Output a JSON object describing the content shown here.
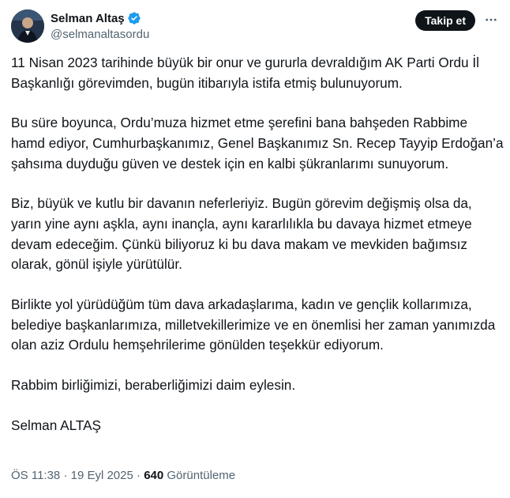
{
  "author": {
    "display_name": "Selman Altaş",
    "handle": "@selmanaltasordu"
  },
  "actions": {
    "follow_label": "Takip et"
  },
  "tweet": {
    "paragraphs": [
      "11 Nisan 2023 tarihinde büyük bir onur ve gururla devraldığım AK Parti Ordu İl Başkanlığı görevimden, bugün itibarıyla istifa etmiş bulunuyorum.",
      "Bu süre boyunca, Ordu’muza hizmet etme şerefini bana bahşeden Rabbime hamd ediyor, Cumhurbaşkanımız, Genel Başkanımız Sn. Recep Tayyip Erdoğan’a şahsıma duyduğu güven ve destek için en kalbi şükranlarımı sunuyorum.",
      "Biz, büyük ve kutlu bir davanın neferleriyiz. Bugün görevim değişmiş olsa da, yarın yine aynı aşkla, aynı inançla, aynı kararlılıkla bu davaya hizmet etmeye devam edeceğim. Çünkü biliyoruz ki bu dava makam ve mevkiden bağımsız olarak, gönül işiyle yürütülür.",
      "Birlikte yol yürüdüğüm tüm dava arkadaşlarıma, kadın ve gençlik kollarımıza, belediye başkanlarımıza, milletvekillerimize ve en önemlisi her zaman yanımızda olan aziz Ordulu hemşehrilerime gönülden teşekkür ediyorum.",
      "Rabbim birliğimizi, beraberliğimizi daim eylesin.",
      "Selman ALTAŞ"
    ]
  },
  "meta": {
    "time": "ÖS 11:38",
    "date": "19 Eyl 2025",
    "separator": "·",
    "views_count": "640",
    "views_label": "Görüntüleme"
  },
  "colors": {
    "text": "#0f1419",
    "secondary": "#536471",
    "verified": "#1d9bf0"
  },
  "icons": {
    "verified": "verified-badge-icon",
    "more": "more-horizontal-icon"
  }
}
